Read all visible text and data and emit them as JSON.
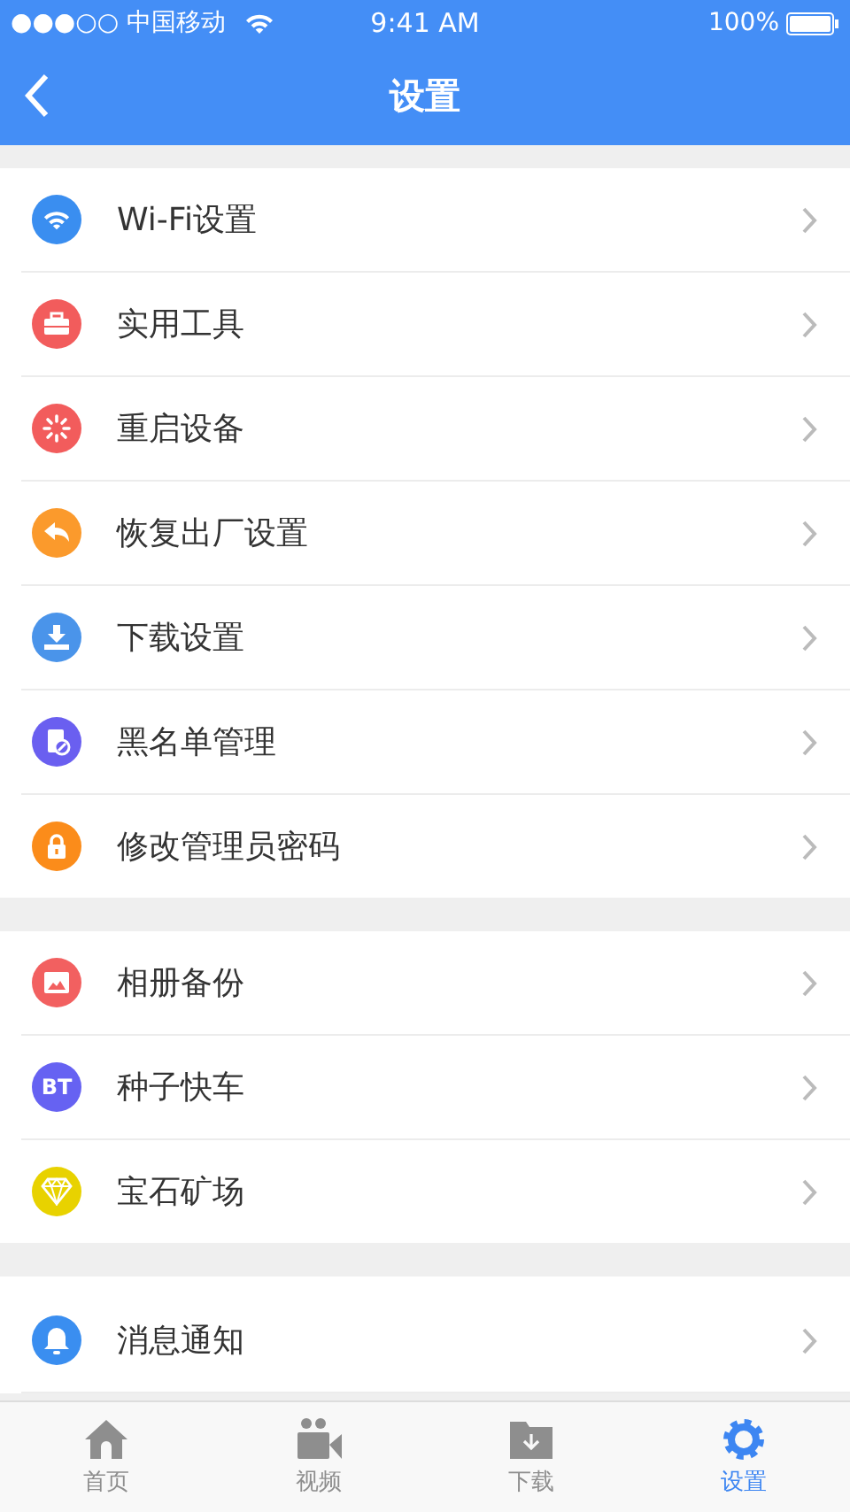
{
  "status_bar": {
    "carrier": "●●●○○ 中国移动",
    "time": "9:41 AM",
    "battery": "100%"
  },
  "nav": {
    "title": "设置"
  },
  "groups": [
    {
      "items": [
        {
          "label": "Wi-Fi设置",
          "kind": "wifi",
          "color": "#3a8ef0"
        },
        {
          "label": "实用工具",
          "kind": "toolbox",
          "color": "#f25c5c"
        },
        {
          "label": "重启设备",
          "kind": "restart",
          "color": "#f25c5c"
        },
        {
          "label": "恢复出厂设置",
          "kind": "undo",
          "color": "#fb9a2c"
        },
        {
          "label": "下载设置",
          "kind": "download",
          "color": "#4a94ea"
        },
        {
          "label": "黑名单管理",
          "kind": "blacklist",
          "color": "#6a5ff0"
        },
        {
          "label": "修改管理员密码",
          "kind": "lock",
          "color": "#fb8c1a"
        }
      ]
    },
    {
      "items": [
        {
          "label": "相册备份",
          "kind": "photo",
          "color": "#f26060"
        },
        {
          "label": "种子快车",
          "kind": "bt",
          "color": "#6662f2",
          "icon_text": "BT"
        },
        {
          "label": "宝石矿场",
          "kind": "gem",
          "color": "#e8d200"
        }
      ]
    },
    {
      "items": [
        {
          "label": "消息通知",
          "kind": "bell",
          "color": "#3a8ef0"
        }
      ]
    }
  ],
  "tabs": [
    {
      "label": "首页",
      "kind": "home",
      "selected": false
    },
    {
      "label": "视频",
      "kind": "video",
      "selected": false
    },
    {
      "label": "下载",
      "kind": "folder",
      "selected": false
    },
    {
      "label": "设置",
      "kind": "gear",
      "selected": true
    }
  ]
}
